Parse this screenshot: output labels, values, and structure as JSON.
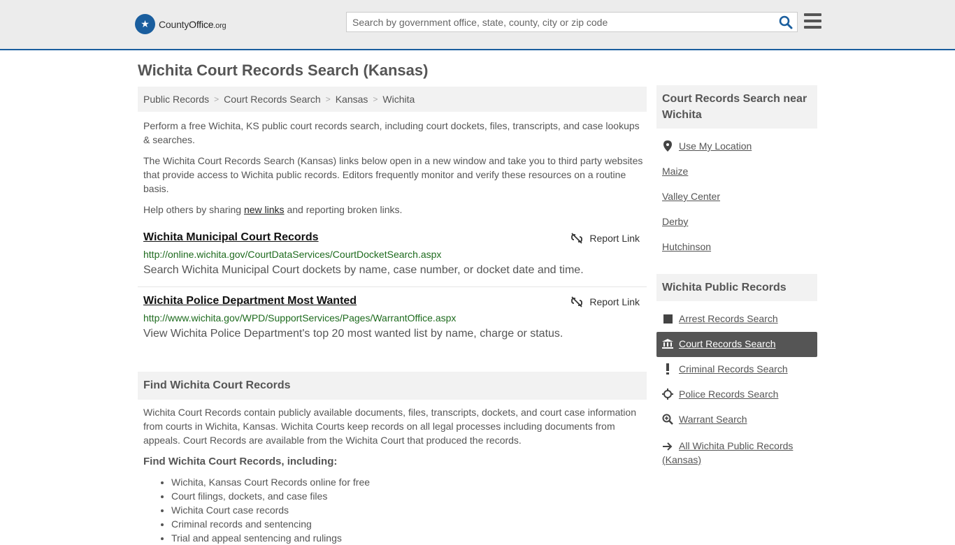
{
  "header": {
    "logo_county": "County",
    "logo_office": "Office",
    "logo_org": ".org",
    "search_placeholder": "Search by government office, state, county, city or zip code"
  },
  "page_title": "Wichita Court Records Search (Kansas)",
  "breadcrumb": [
    "Public Records",
    "Court Records Search",
    "Kansas",
    "Wichita"
  ],
  "intro": {
    "p1": "Perform a free Wichita, KS public court records search, including court dockets, files, transcripts, and case lookups & searches.",
    "p2": "The Wichita Court Records Search (Kansas) links below open in a new window and take you to third party websites that provide access to Wichita public records. Editors frequently monitor and verify these resources on a routine basis.",
    "p3_before": "Help others by sharing ",
    "p3_link": "new links",
    "p3_after": " and reporting broken links."
  },
  "results": [
    {
      "title": "Wichita Municipal Court Records",
      "url": "http://online.wichita.gov/CourtDataServices/CourtDocketSearch.aspx",
      "desc": "Search Wichita Municipal Court dockets by name, case number, or docket date and time.",
      "report": "Report Link"
    },
    {
      "title": "Wichita Police Department Most Wanted",
      "url": "http://www.wichita.gov/WPD/SupportServices/Pages/WarrantOffice.aspx",
      "desc": "View Wichita Police Department's top 20 most wanted list by name, charge or status.",
      "report": "Report Link"
    }
  ],
  "find_section": {
    "heading": "Find Wichita Court Records",
    "body": "Wichita Court Records contain publicly available documents, files, transcripts, dockets, and court case information from courts in Wichita, Kansas. Wichita Courts keep records on all legal processes including documents from appeals. Court Records are available from the Wichita Court that produced the records.",
    "subheading": "Find Wichita Court Records, including:",
    "bullets": [
      "Wichita, Kansas Court Records online for free",
      "Court filings, dockets, and case files",
      "Wichita Court case records",
      "Criminal records and sentencing",
      "Trial and appeal sentencing and rulings"
    ]
  },
  "sidebar": {
    "near_heading": "Court Records Search near Wichita",
    "near_links": [
      "Use My Location",
      "Maize",
      "Valley Center",
      "Derby",
      "Hutchinson"
    ],
    "public_heading": "Wichita Public Records",
    "public_links": [
      {
        "label": "Arrest Records Search",
        "icon": "square-icon"
      },
      {
        "label": "Court Records Search",
        "icon": "courthouse-icon"
      },
      {
        "label": "Criminal Records Search",
        "icon": "exclamation-icon"
      },
      {
        "label": "Police Records Search",
        "icon": "crosshair-icon"
      },
      {
        "label": "Warrant Search",
        "icon": "magnify-plus-icon"
      },
      {
        "label": "All Wichita Public Records (Kansas)",
        "icon": "arrow-right-icon"
      }
    ],
    "active_index": 1
  }
}
